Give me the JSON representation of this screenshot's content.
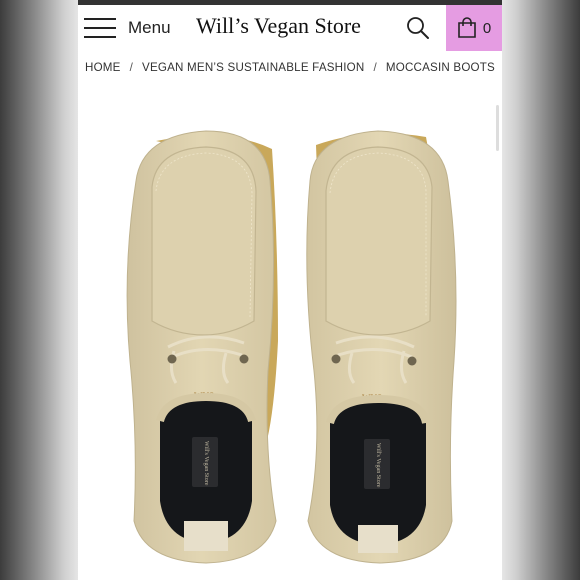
{
  "header": {
    "menu_label": "Menu",
    "store_title": "Will’s Vegan Store",
    "cart_count": "0",
    "accent_color": "#e59ce2"
  },
  "breadcrumb": {
    "items": [
      "HOME",
      "VEGAN MEN’S SUSTAINABLE FASHION",
      "MOCCASIN BOOTS"
    ],
    "separator": "/"
  },
  "product": {
    "image_alt": "Beige suede moccasin boots, top view",
    "logo_text": "WVS",
    "insole_label": "Will's Vegan Store",
    "colors": {
      "suede": "#ddd0ac",
      "sole": "#c9a85a",
      "lining": "#15171a"
    }
  },
  "icons": {
    "menu": "hamburger-icon",
    "search": "search-icon",
    "cart": "shopping-bag-icon"
  }
}
